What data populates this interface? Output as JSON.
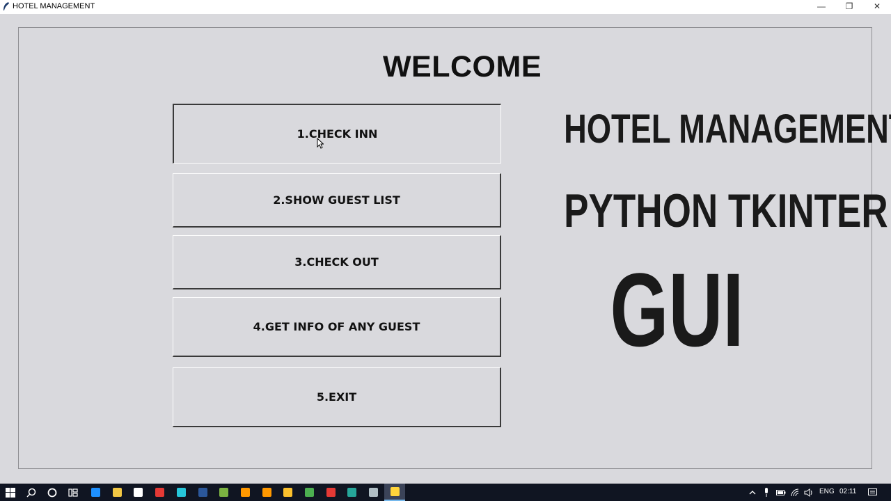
{
  "window": {
    "title": "HOTEL MANAGEMENT",
    "minimize_glyph": "—",
    "maximize_glyph": "❐",
    "close_glyph": "✕"
  },
  "main": {
    "heading": "WELCOME",
    "menu_buttons": [
      {
        "label": "1.CHECK INN"
      },
      {
        "label": "2.SHOW GUEST LIST"
      },
      {
        "label": "3.CHECK OUT"
      },
      {
        "label": "4.GET INFO OF ANY GUEST"
      },
      {
        "label": "5.EXIT"
      }
    ],
    "banner": {
      "line1": "HOTEL MANAGEMENT",
      "line2": "PYTHON TKINTER",
      "line3": "GUI"
    }
  },
  "taskbar": {
    "apps": [
      {
        "icon": "edge-icon",
        "color": "#1e90ff"
      },
      {
        "icon": "file-explorer-icon",
        "color": "#f2c744"
      },
      {
        "icon": "mail-icon",
        "color": "#ffffff"
      },
      {
        "icon": "app-red-icon",
        "color": "#e53935"
      },
      {
        "icon": "app-teal-icon",
        "color": "#26c6da"
      },
      {
        "icon": "word-icon",
        "color": "#2b579a"
      },
      {
        "icon": "notepad-icon",
        "color": "#7cb342"
      },
      {
        "icon": "app-orange-icon",
        "color": "#ff9800"
      },
      {
        "icon": "sublime-icon",
        "color": "#ff9800"
      },
      {
        "icon": "app-gold-icon",
        "color": "#fbc02d"
      },
      {
        "icon": "chrome-icon",
        "color": "#4caf50"
      },
      {
        "icon": "opera-icon",
        "color": "#e53935"
      },
      {
        "icon": "media-icon",
        "color": "#26a69a"
      },
      {
        "icon": "app-gray-icon",
        "color": "#b0bec5"
      },
      {
        "icon": "python-icon",
        "color": "#ffd43b"
      }
    ],
    "language": "ENG",
    "time": "02:11"
  }
}
